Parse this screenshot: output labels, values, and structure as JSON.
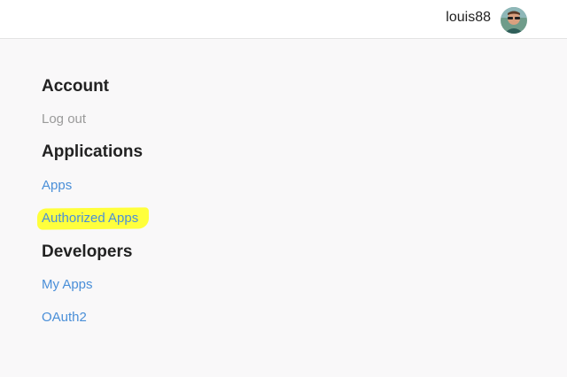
{
  "header": {
    "username": "louis88",
    "avatar_icon": "user-avatar-icon"
  },
  "sections": {
    "account": {
      "title": "Account",
      "links": [
        "Log out"
      ]
    },
    "applications": {
      "title": "Applications",
      "links": [
        "Apps",
        "Authorized Apps"
      ]
    },
    "developers": {
      "title": "Developers",
      "links": [
        "My Apps",
        "OAuth2"
      ]
    }
  },
  "colors": {
    "link": "#4a8fd8",
    "muted_link": "#9a9a9a",
    "highlight": "#ffff3c",
    "background": "#f9f8f9"
  }
}
